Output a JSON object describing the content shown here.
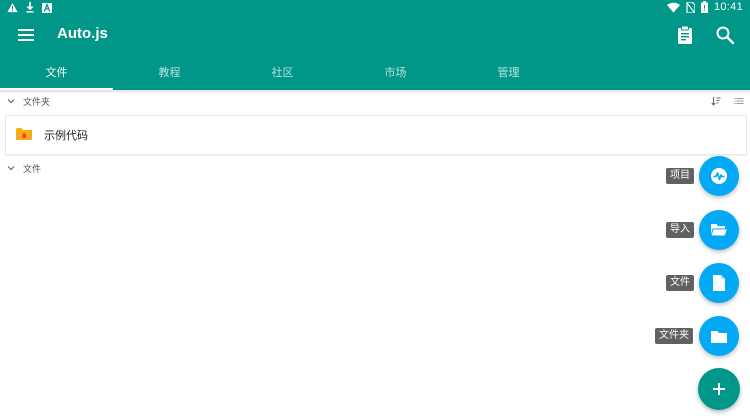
{
  "status_bar": {
    "time": "10:41",
    "left_icons": [
      "warning-icon",
      "download-icon",
      "a-box-icon"
    ],
    "right_icons": [
      "wifi-icon",
      "no-sim-icon",
      "battery-icon"
    ]
  },
  "toolbar": {
    "title": "Auto.js",
    "menu_icon": "menu-icon",
    "actions": [
      "clipboard-icon",
      "search-icon"
    ]
  },
  "tabs": [
    {
      "label": "文件",
      "active": true
    },
    {
      "label": "教程",
      "active": false
    },
    {
      "label": "社区",
      "active": false
    },
    {
      "label": "市场",
      "active": false
    },
    {
      "label": "管理",
      "active": false
    }
  ],
  "sections": {
    "folders": {
      "label": "文件夹",
      "icons": [
        "sort-icon",
        "list-icon"
      ]
    },
    "files": {
      "label": "文件"
    }
  },
  "folders": [
    {
      "name": "示例代码"
    }
  ],
  "fab_menu": [
    {
      "label": "项目",
      "icon": "project-icon"
    },
    {
      "label": "导入",
      "icon": "folder-open-icon"
    },
    {
      "label": "文件",
      "icon": "file-icon"
    },
    {
      "label": "文件夹",
      "icon": "folder-icon"
    }
  ],
  "fab_main_icon": "add-icon",
  "colors": {
    "primary": "#009688",
    "accent_fab": "#03a9f4",
    "label_bg": "#616161",
    "folder": "#f4b400"
  }
}
